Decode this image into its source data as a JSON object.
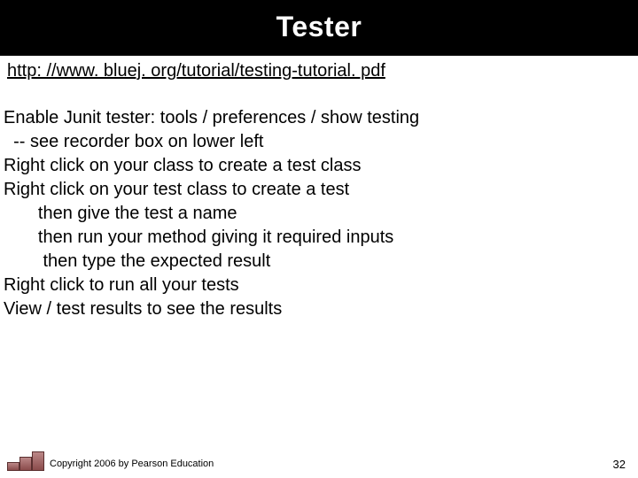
{
  "title": "Tester",
  "link": "http: //www. bluej. org/tutorial/testing-tutorial. pdf",
  "lines": {
    "l1": "Enable Junit tester: tools / preferences / show testing",
    "l2": "  -- see recorder box on lower left",
    "l3": "Right click on your class to create a test class",
    "l4": "Right click on your test class to create a test",
    "l5": "       then give the test a name",
    "l6": "       then run your method giving it required inputs",
    "l7": "        then type the expected result",
    "l8": "Right click to run all your tests",
    "l9": "View / test results to see the results"
  },
  "copyright": "Copyright 2006 by Pearson Education",
  "page_number": "32"
}
